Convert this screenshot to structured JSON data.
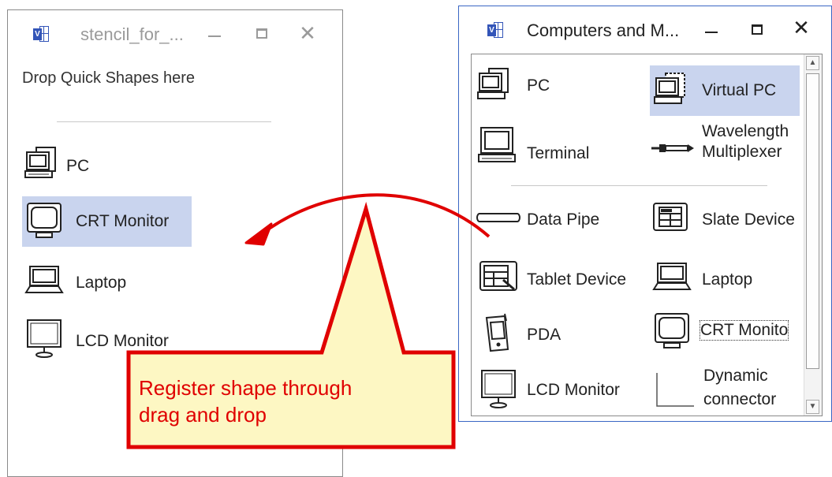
{
  "left_window": {
    "title": "stencil_for_...",
    "placeholder": "Drop Quick Shapes here",
    "items": [
      {
        "label": "PC",
        "icon": "pc-icon",
        "selected": false
      },
      {
        "label": "CRT Monitor",
        "icon": "crt-monitor-icon",
        "selected": true
      },
      {
        "label": "Laptop",
        "icon": "laptop-icon",
        "selected": false
      },
      {
        "label": "LCD Monitor",
        "icon": "lcd-monitor-icon",
        "selected": false
      }
    ]
  },
  "right_window": {
    "title": "Computers and M...",
    "shapes": [
      {
        "label": "PC",
        "icon": "pc-icon"
      },
      {
        "label": "Virtual PC",
        "icon": "virtual-pc-icon",
        "selected": true
      },
      {
        "label": "Terminal",
        "icon": "terminal-icon"
      },
      {
        "label_line1": "Wavelength",
        "label_line2": "Multiplexer",
        "icon": "wavelength-multiplexer-icon"
      },
      {
        "label": "Data Pipe",
        "icon": "data-pipe-icon"
      },
      {
        "label": "Slate Device",
        "icon": "slate-device-icon"
      },
      {
        "label": "Tablet Device",
        "icon": "tablet-device-icon"
      },
      {
        "label": "Laptop",
        "icon": "laptop-icon"
      },
      {
        "label": "PDA",
        "icon": "pda-icon"
      },
      {
        "label": "CRT Monito",
        "icon": "crt-monitor-icon"
      },
      {
        "label": "LCD Monitor",
        "icon": "lcd-monitor-icon"
      },
      {
        "label_line1": "Dynamic",
        "label_line2": "connector",
        "icon": "dynamic-connector-icon"
      }
    ]
  },
  "callout": {
    "line1": "Register shape through",
    "line2": "drag and drop",
    "border_color": "#e00000",
    "fill_color": "#fdf7c3"
  },
  "colors": {
    "selection": "#c9d4ee",
    "active_border": "#3a66c4",
    "arrow": "#e00000"
  }
}
